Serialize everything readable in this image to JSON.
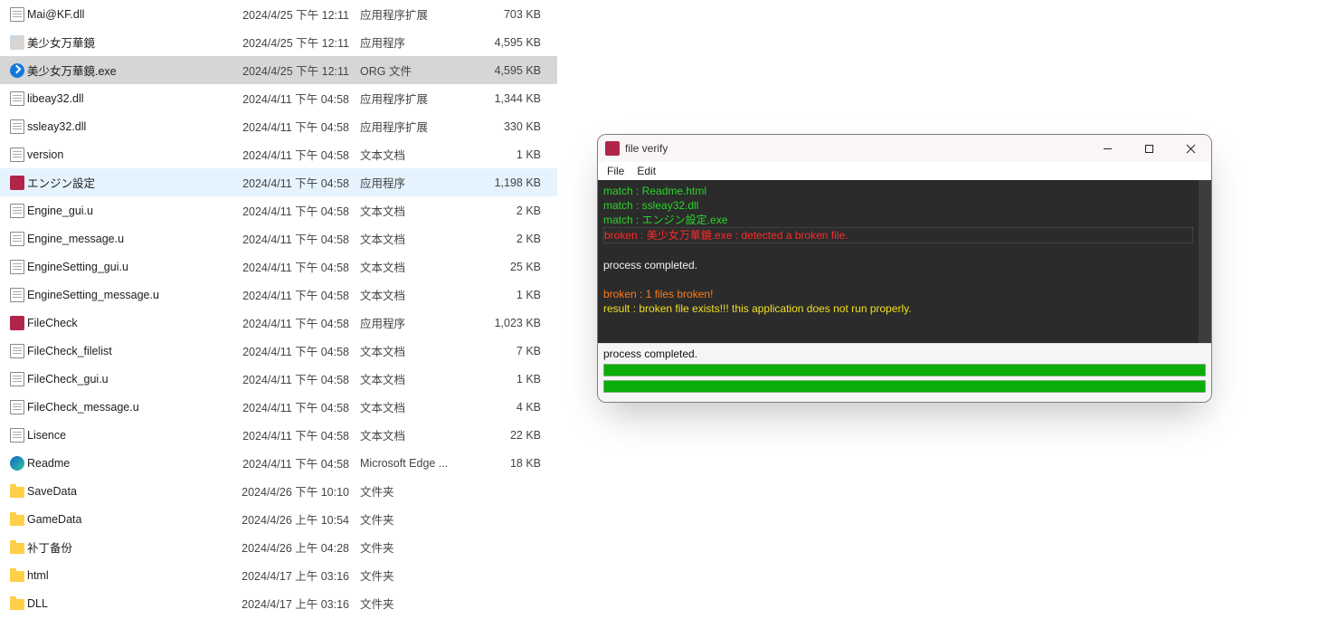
{
  "explorer": {
    "files": [
      {
        "icon": "dll",
        "name": "Mai@KF.dll",
        "date": "2024/4/25 下午 12:11",
        "type": "应用程序扩展",
        "size": "703 KB",
        "state": ""
      },
      {
        "icon": "img",
        "name": "美少女万華鏡",
        "date": "2024/4/25 下午 12:11",
        "type": "应用程序",
        "size": "4,595 KB",
        "state": ""
      },
      {
        "icon": "blue",
        "name": "美少女万華鏡.exe",
        "date": "2024/4/25 下午 12:11",
        "type": "ORG 文件",
        "size": "4,595 KB",
        "state": "selected"
      },
      {
        "icon": "dll",
        "name": "libeay32.dll",
        "date": "2024/4/11 下午 04:58",
        "type": "应用程序扩展",
        "size": "1,344 KB",
        "state": ""
      },
      {
        "icon": "dll",
        "name": "ssleay32.dll",
        "date": "2024/4/11 下午 04:58",
        "type": "应用程序扩展",
        "size": "330 KB",
        "state": ""
      },
      {
        "icon": "doc",
        "name": "version",
        "date": "2024/4/11 下午 04:58",
        "type": "文本文档",
        "size": "1 KB",
        "state": ""
      },
      {
        "icon": "red",
        "name": "エンジン設定",
        "date": "2024/4/11 下午 04:58",
        "type": "应用程序",
        "size": "1,198 KB",
        "state": "hover"
      },
      {
        "icon": "doc",
        "name": "Engine_gui.u",
        "date": "2024/4/11 下午 04:58",
        "type": "文本文档",
        "size": "2 KB",
        "state": ""
      },
      {
        "icon": "doc",
        "name": "Engine_message.u",
        "date": "2024/4/11 下午 04:58",
        "type": "文本文档",
        "size": "2 KB",
        "state": ""
      },
      {
        "icon": "doc",
        "name": "EngineSetting_gui.u",
        "date": "2024/4/11 下午 04:58",
        "type": "文本文档",
        "size": "25 KB",
        "state": ""
      },
      {
        "icon": "doc",
        "name": "EngineSetting_message.u",
        "date": "2024/4/11 下午 04:58",
        "type": "文本文档",
        "size": "1 KB",
        "state": ""
      },
      {
        "icon": "red",
        "name": "FileCheck",
        "date": "2024/4/11 下午 04:58",
        "type": "应用程序",
        "size": "1,023 KB",
        "state": ""
      },
      {
        "icon": "doc",
        "name": "FileCheck_filelist",
        "date": "2024/4/11 下午 04:58",
        "type": "文本文档",
        "size": "7 KB",
        "state": ""
      },
      {
        "icon": "doc",
        "name": "FileCheck_gui.u",
        "date": "2024/4/11 下午 04:58",
        "type": "文本文档",
        "size": "1 KB",
        "state": ""
      },
      {
        "icon": "doc",
        "name": "FileCheck_message.u",
        "date": "2024/4/11 下午 04:58",
        "type": "文本文档",
        "size": "4 KB",
        "state": ""
      },
      {
        "icon": "doc",
        "name": "Lisence",
        "date": "2024/4/11 下午 04:58",
        "type": "文本文档",
        "size": "22 KB",
        "state": ""
      },
      {
        "icon": "edge",
        "name": "Readme",
        "date": "2024/4/11 下午 04:58",
        "type": "Microsoft Edge ...",
        "size": "18 KB",
        "state": ""
      },
      {
        "icon": "folder",
        "name": "SaveData",
        "date": "2024/4/26 下午 10:10",
        "type": "文件夹",
        "size": "",
        "state": ""
      },
      {
        "icon": "folder",
        "name": "GameData",
        "date": "2024/4/26 上午 10:54",
        "type": "文件夹",
        "size": "",
        "state": ""
      },
      {
        "icon": "folder",
        "name": "补丁备份",
        "date": "2024/4/26 上午 04:28",
        "type": "文件夹",
        "size": "",
        "state": ""
      },
      {
        "icon": "folder",
        "name": "html",
        "date": "2024/4/17 上午 03:16",
        "type": "文件夹",
        "size": "",
        "state": ""
      },
      {
        "icon": "folder",
        "name": "DLL",
        "date": "2024/4/17 上午 03:16",
        "type": "文件夹",
        "size": "",
        "state": ""
      }
    ]
  },
  "popup": {
    "title": "file verify",
    "menu": {
      "file": "File",
      "edit": "Edit"
    },
    "console": [
      {
        "cls": "c-green",
        "text": "match : Readme.html"
      },
      {
        "cls": "c-green",
        "text": "match : ssleay32.dll"
      },
      {
        "cls": "c-green",
        "text": "match : エンジン設定.exe"
      },
      {
        "cls": "c-red broken-row",
        "text": "broken : 美少女万華鏡.exe : detected a broken file."
      },
      {
        "cls": "",
        "text": " "
      },
      {
        "cls": "c-white",
        "text": "process completed."
      },
      {
        "cls": "",
        "text": " "
      },
      {
        "cls": "c-orange",
        "text": "broken : 1 files broken!"
      },
      {
        "cls": "c-yellow",
        "text": "result : broken file exists!!! this application does not run properly."
      }
    ],
    "status": "process completed."
  }
}
